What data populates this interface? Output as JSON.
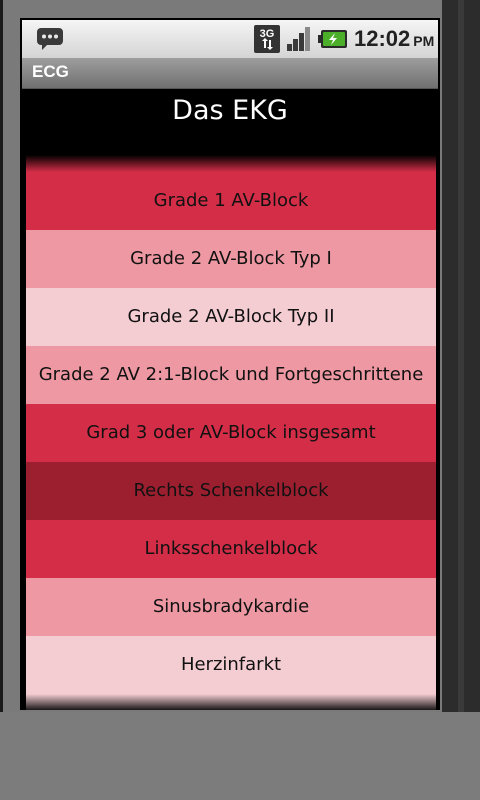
{
  "status_bar": {
    "time": "12:02",
    "ampm": "PM",
    "network_label": "3G",
    "icons": [
      "message-icon",
      "3g-data-icon",
      "signal-icon",
      "battery-charging-icon"
    ]
  },
  "app": {
    "title": "ECG"
  },
  "header": {
    "title": "Das EKG"
  },
  "colors": {
    "red": "#d32d47",
    "pink": "#ed98a2",
    "light": "#f4cdd3",
    "dark": "#9c1f30"
  },
  "list": {
    "items": [
      {
        "label": "Grade 1 AV-Block",
        "color": "red"
      },
      {
        "label": "Grade 2 AV-Block Typ I",
        "color": "pink"
      },
      {
        "label": "Grade 2 AV-Block Typ II",
        "color": "light"
      },
      {
        "label": "Grade 2 AV 2:1-Block und Fortgeschrittene",
        "color": "pink"
      },
      {
        "label": "Grad 3 oder AV-Block insgesamt",
        "color": "red"
      },
      {
        "label": "Rechts Schenkelblock",
        "color": "dark"
      },
      {
        "label": "Linksschenkelblock",
        "color": "red"
      },
      {
        "label": "Sinusbradykardie",
        "color": "pink"
      },
      {
        "label": "Herzinfarkt",
        "color": "light"
      }
    ]
  }
}
